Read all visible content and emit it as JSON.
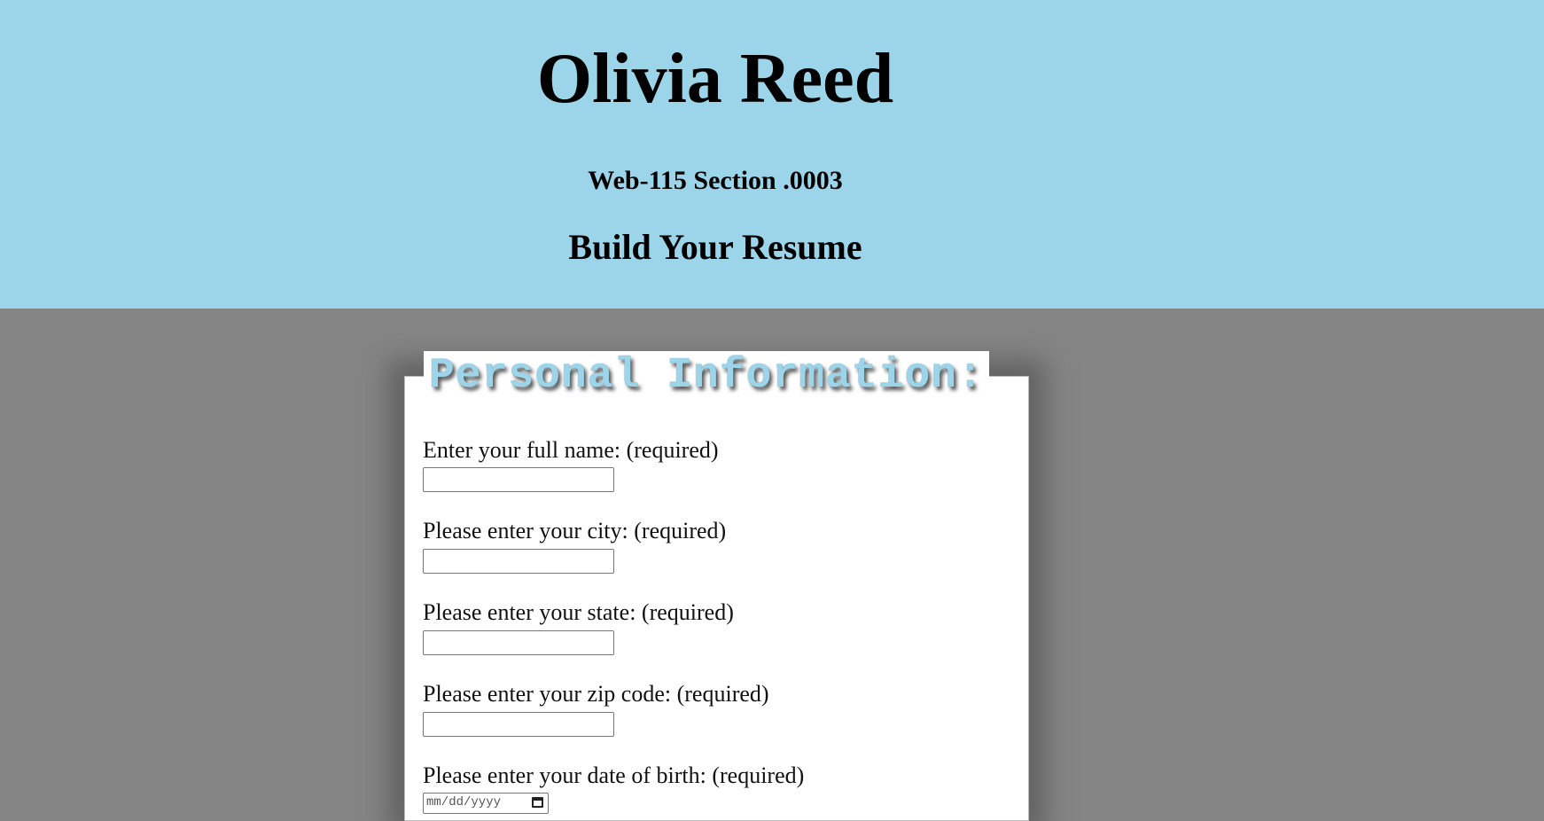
{
  "header": {
    "title": "Olivia Reed",
    "section": "Web-115 Section .0003",
    "subtitle": "Build Your Resume"
  },
  "form": {
    "legend": "Personal Information:",
    "fields": [
      {
        "label": "Enter your full name: (required)",
        "value": ""
      },
      {
        "label": "Please enter your city: (required)",
        "value": ""
      },
      {
        "label": "Please enter your state: (required)",
        "value": ""
      },
      {
        "label": "Please enter your zip code: (required)",
        "value": ""
      },
      {
        "label": "Please enter your date of birth: (required)",
        "placeholder": "mm/dd/yyyy"
      }
    ]
  },
  "colors": {
    "header_background": "#9cd5ea",
    "page_background": "#858585",
    "legend_text": "#9cd5ea"
  }
}
